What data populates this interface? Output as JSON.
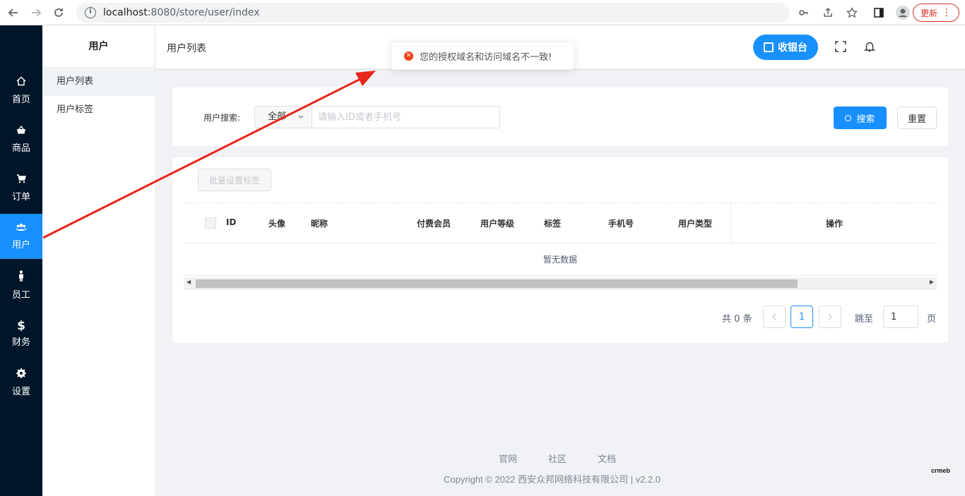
{
  "browser": {
    "url_host": "localhost",
    "url_path": ":8080/store/user/index",
    "update_label": "更新"
  },
  "dark_nav": [
    {
      "label": "首页",
      "icon": "home-icon",
      "glyph": "⌂"
    },
    {
      "label": "商品",
      "icon": "basket-icon",
      "glyph": "🛍"
    },
    {
      "label": "订单",
      "icon": "cart-icon",
      "glyph": "🛒"
    },
    {
      "label": "用户",
      "icon": "users-icon",
      "glyph": "👥",
      "active": true
    },
    {
      "label": "员工",
      "icon": "person-icon",
      "glyph": "👤"
    },
    {
      "label": "财务",
      "icon": "dollar-icon",
      "glyph": "$"
    },
    {
      "label": "设置",
      "icon": "settings-icon",
      "glyph": "✺"
    }
  ],
  "sub_nav": {
    "title": "用户",
    "items": [
      {
        "label": "用户列表",
        "active": true
      },
      {
        "label": "用户标签"
      }
    ]
  },
  "header": {
    "breadcrumb": "用户列表",
    "cashier_label": "收银台"
  },
  "toast": {
    "message": "您的授权域名和访问域名不一致!",
    "type": "error"
  },
  "search": {
    "label": "用户搜索:",
    "select_value": "全部",
    "placeholder": "请输入ID或者手机号",
    "search_label": "搜索",
    "reset_label": "重置"
  },
  "table": {
    "batch_label": "批量设置标签",
    "columns": [
      "ID",
      "头像",
      "昵称",
      "付费会员",
      "用户等级",
      "标签",
      "手机号",
      "用户类型",
      "操作"
    ],
    "empty_text": "暂无数据"
  },
  "pager": {
    "total_text": "共 0 条",
    "current_page": "1",
    "jump_label": "跳至",
    "jump_value": "1",
    "page_unit": "页"
  },
  "footer": {
    "links": [
      "官网",
      "社区",
      "文档"
    ],
    "copyright": "Copyright © 2022 西安众邦网络科技有限公司 | v2.2.0",
    "logo_text": "crmeb"
  },
  "colors": {
    "primary": "#1890ff",
    "sidebar_dark": "#001529",
    "error": "#ed4014",
    "annotation_arrow": "#e8261c"
  }
}
